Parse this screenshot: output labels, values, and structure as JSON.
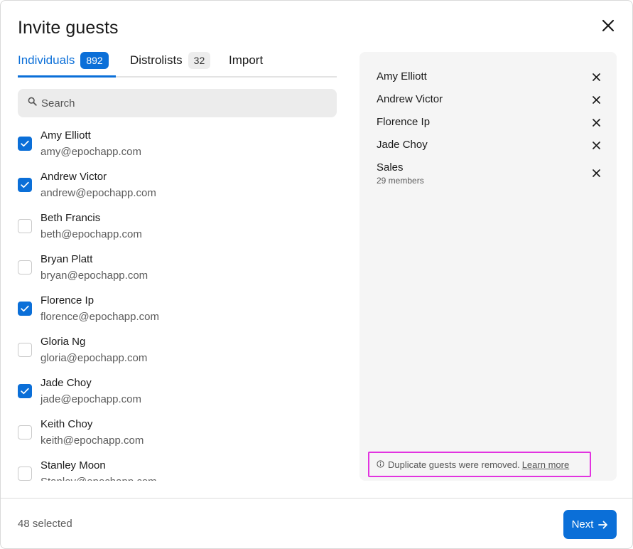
{
  "title": "Invite guests",
  "tabs": [
    {
      "label": "Individuals",
      "count": "892"
    },
    {
      "label": "Distrolists",
      "count": "32"
    },
    {
      "label": "Import"
    }
  ],
  "search": {
    "placeholder": "Search",
    "value": ""
  },
  "people": [
    {
      "name": "Amy Elliott",
      "email": "amy@epochapp.com",
      "checked": true
    },
    {
      "name": "Andrew Victor",
      "email": "andrew@epochapp.com",
      "checked": true
    },
    {
      "name": "Beth Francis",
      "email": "beth@epochapp.com",
      "checked": false
    },
    {
      "name": "Bryan Platt",
      "email": "bryan@epochapp.com",
      "checked": false
    },
    {
      "name": "Florence Ip",
      "email": "florence@epochapp.com",
      "checked": true
    },
    {
      "name": "Gloria Ng",
      "email": "gloria@epochapp.com",
      "checked": false
    },
    {
      "name": "Jade Choy",
      "email": "jade@epochapp.com",
      "checked": true
    },
    {
      "name": "Keith Choy",
      "email": "keith@epochapp.com",
      "checked": false
    },
    {
      "name": "Stanley Moon",
      "email": "Stanley@epochapp.com",
      "checked": false
    }
  ],
  "selected": [
    {
      "name": "Amy Elliott"
    },
    {
      "name": "Andrew Victor"
    },
    {
      "name": "Florence Ip"
    },
    {
      "name": "Jade Choy"
    },
    {
      "name": "Sales",
      "sub": "29 members"
    }
  ],
  "notice": {
    "text": "Duplicate guests were removed.",
    "link": "Learn more"
  },
  "footer": {
    "selected_count": "48 selected",
    "next_label": "Next"
  },
  "colors": {
    "accent": "#0b6fd8",
    "highlight": "#e233e0"
  },
  "icons": {
    "close": "close-icon",
    "search": "search-icon",
    "check": "check-icon",
    "info": "info-icon",
    "arrow": "arrow-right-icon"
  }
}
